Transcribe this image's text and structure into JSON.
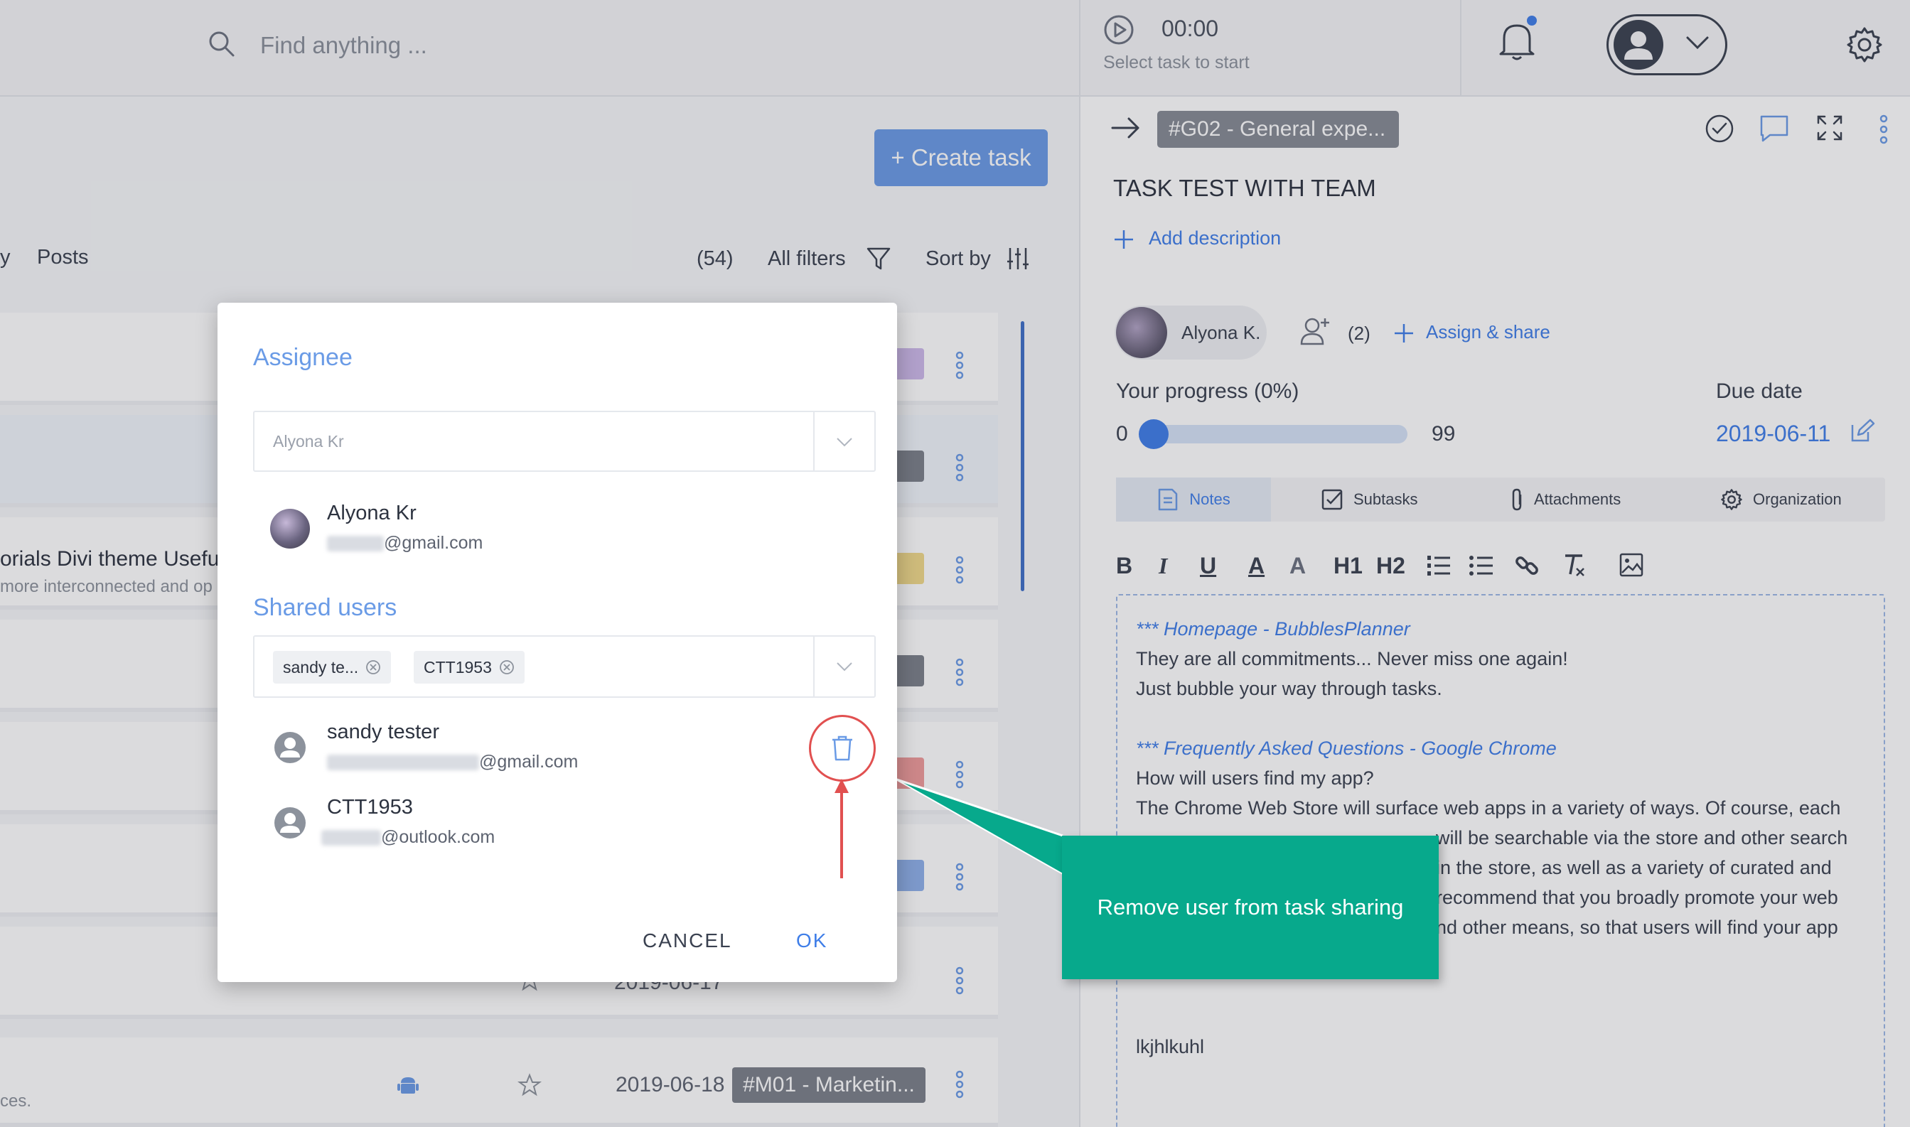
{
  "topbar": {
    "search_placeholder": "Find anything ...",
    "timer": "00:00",
    "timer_hint": "Select task to start"
  },
  "list": {
    "create_task_label": "+ Create task",
    "tab_fragment": "y",
    "posts_tab": "Posts",
    "count": "(54)",
    "all_filters": "All filters",
    "sort_by": "Sort by",
    "visible_task_title": "orials Divi theme Useful",
    "visible_task_sub": "more interconnected and op",
    "bottom_row_sub": "ces.",
    "date_row1": "2019-06-17",
    "date_row2": "2019-06-18",
    "row_tag": "#M01 - Marketin..."
  },
  "panel": {
    "task_tag": "#G02 - General expe...",
    "task_title": "TASK TEST WITH TEAM",
    "add_description": "Add description",
    "assignee_name": "Alyona K.",
    "shared_count": "(2)",
    "assign_share": "Assign & share",
    "progress_label": "Your progress  (0%)",
    "progress_min": "0",
    "progress_max": "99",
    "progress_percent": 0,
    "due_label": "Due date",
    "due_value": "2019-06-11",
    "tabs": [
      {
        "label": "Notes",
        "icon": "notes-icon"
      },
      {
        "label": "Subtasks",
        "icon": "checkbox-icon"
      },
      {
        "label": "Attachments",
        "icon": "paperclip-icon"
      },
      {
        "label": "Organization",
        "icon": "gear-icon"
      }
    ],
    "toolbar": [
      "B",
      "I",
      "U",
      "A",
      "A",
      "H1",
      "H2"
    ],
    "notes": {
      "link1": "*** Homepage - BubblesPlanner",
      "line1": "They are all commitments... Never miss one again!",
      "line2": "Just bubble your way through tasks.",
      "link2": "*** Frequently Asked Questions - Google Chrome",
      "line3": "How will users find my app?",
      "line4": "The Chrome Web Store will surface web apps in a variety of ways. Of course, each",
      "line5a": "...",
      "line5b": "will be searchable via the store and other search",
      "line6b": "in the store, as well as a variety of curated and",
      "line7b": "recommend that you broadly promote your web",
      "line8b": "nd other means, so that users will find your app",
      "line9": "lkjhlkuhl"
    }
  },
  "modal": {
    "assignee_title": "Assignee",
    "assignee_placeholder": "Alyona Kr",
    "assignee_name": "Alyona Kr",
    "assignee_email": "@gmail.com",
    "shared_title": "Shared users",
    "tags": [
      "sandy te...",
      "CTT1953"
    ],
    "users": [
      {
        "name": "sandy tester",
        "email": "@gmail.com"
      },
      {
        "name": "CTT1953",
        "email": "@outlook.com"
      }
    ],
    "cancel": "CANCEL",
    "ok": "OK"
  },
  "callout": {
    "text": "Remove user from task sharing",
    "color": "#07a98c"
  },
  "colors": {
    "accent": "#3f7ee8",
    "modal_title": "#6a9be6",
    "highlight_ring": "#e15050"
  }
}
